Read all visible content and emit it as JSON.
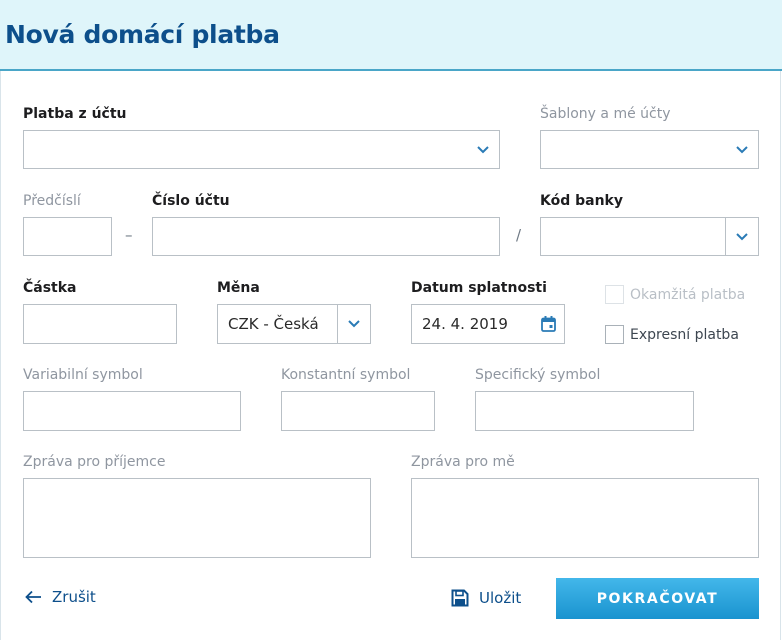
{
  "page": {
    "title": "Nová domácí platba"
  },
  "form": {
    "account_from": {
      "label": "Platba z účtu",
      "value": ""
    },
    "templates": {
      "label": "Šablony a mé účty",
      "value": ""
    },
    "prefix": {
      "label": "Předčíslí",
      "value": ""
    },
    "prefix_separator": "–",
    "account_number": {
      "label": "Číslo účtu",
      "value": ""
    },
    "bank_separator": "/",
    "bank_code": {
      "label": "Kód banky",
      "value": ""
    },
    "amount": {
      "label": "Částka",
      "value": ""
    },
    "currency": {
      "label": "Měna",
      "value": "CZK - Česká"
    },
    "due_date": {
      "label": "Datum splatnosti",
      "value": "24. 4. 2019"
    },
    "instant_payment": {
      "label": "Okamžitá platba",
      "checked": false,
      "disabled": true
    },
    "express_payment": {
      "label": "Expresní platba",
      "checked": false,
      "disabled": false
    },
    "variable_symbol": {
      "label": "Variabilní symbol",
      "value": ""
    },
    "constant_symbol": {
      "label": "Konstantní symbol",
      "value": ""
    },
    "specific_symbol": {
      "label": "Specifický symbol",
      "value": ""
    },
    "message_recipient": {
      "label": "Zpráva pro příjemce",
      "value": ""
    },
    "message_me": {
      "label": "Zpráva pro mě",
      "value": ""
    }
  },
  "actions": {
    "cancel": "Zrušit",
    "save": "Uložit",
    "continue": "POKRAČOVAT"
  },
  "icons": {
    "chevron": "chevron-down-icon",
    "calendar": "calendar-icon",
    "back": "arrow-left-icon",
    "save": "floppy-disk-icon"
  },
  "colors": {
    "brand": "#0d4f8b",
    "header_bg": "#dff5fa",
    "header_border": "#4aa6c8",
    "accent": "#2a9fd6",
    "field_border": "#b9c0c6"
  }
}
